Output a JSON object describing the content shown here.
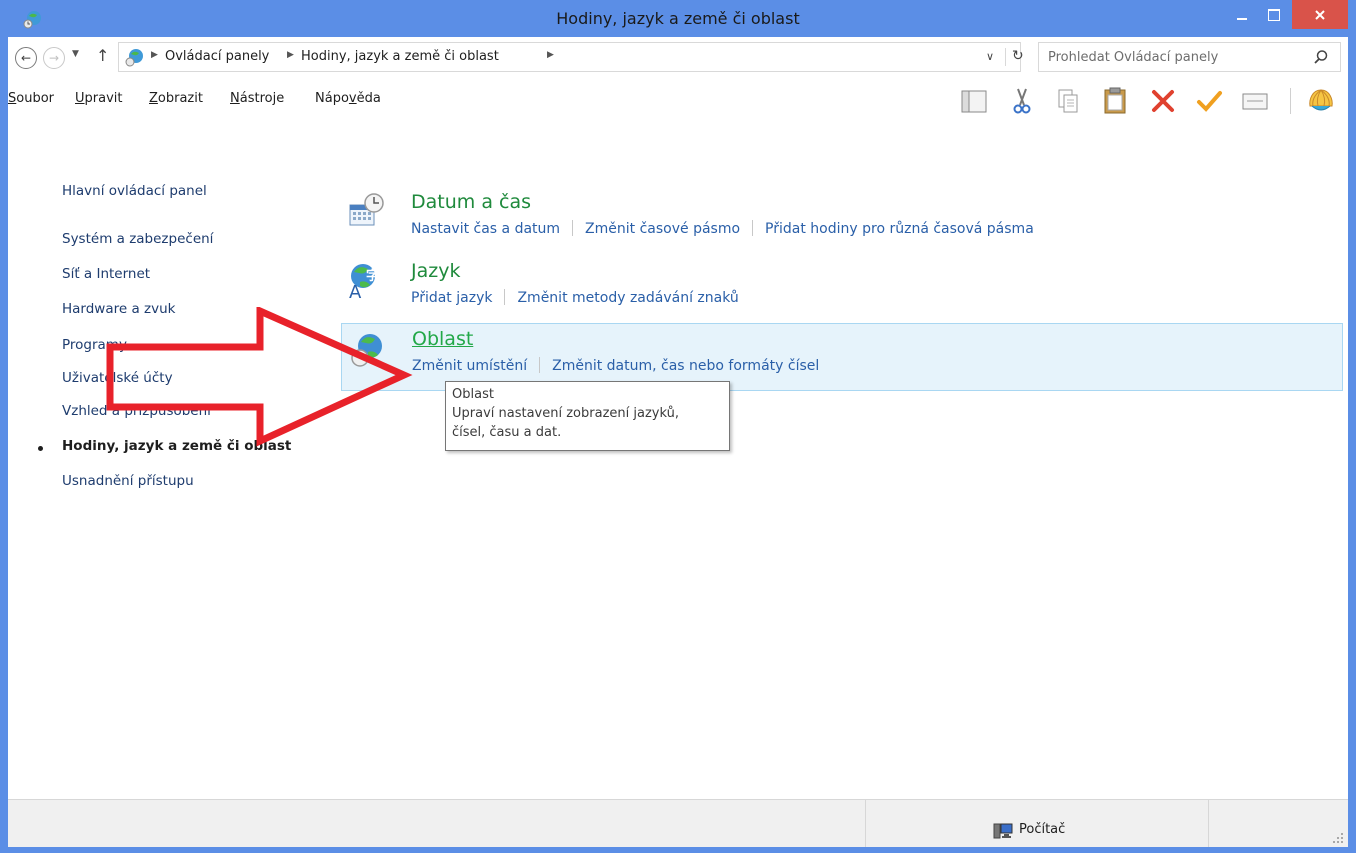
{
  "window": {
    "title": "Hodiny, jazyk a země či oblast",
    "accent": "#5b8ee6",
    "close_color": "#d9534a"
  },
  "address": {
    "crumbs": [
      "Ovládací panely",
      "Hodiny, jazyk a země či oblast"
    ],
    "search_placeholder": "Prohledat Ovládací panely"
  },
  "menu": {
    "items": [
      {
        "accel": "S",
        "rest": "oubor"
      },
      {
        "accel": "U",
        "rest": "pravit"
      },
      {
        "accel": "Z",
        "rest": "obrazit"
      },
      {
        "accel": "N",
        "rest": "ástroje"
      },
      {
        "pre": "Nápo",
        "accel": "v",
        "rest": "ěda"
      }
    ]
  },
  "sidebar": {
    "home": "Hlavní ovládací panel",
    "items": [
      "Systém a zabezpečení",
      "Síť a Internet",
      "Hardware a zvuk",
      "Programy",
      "Uživatelské účty",
      "Vzhled a přizpůsobení",
      "Hodiny, jazyk a země či oblast",
      "Usnadnění přístupu"
    ],
    "current_index": 6
  },
  "categories": [
    {
      "title": "Datum a čas",
      "icon": "calendar-clock-icon",
      "links": [
        "Nastavit čas a datum",
        "Změnit časové pásmo",
        "Přidat hodiny pro různá časová pásma"
      ]
    },
    {
      "title": "Jazyk",
      "icon": "language-globe-icon",
      "links": [
        "Přidat jazyk",
        "Změnit metody zadávání znaků"
      ]
    },
    {
      "title": "Oblast",
      "icon": "region-globe-clock-icon",
      "links": [
        "Změnit umístění",
        "Změnit datum, čas nebo formáty čísel"
      ],
      "highlighted": true
    }
  ],
  "tooltip": {
    "title": "Oblast",
    "line1": "Upraví nastavení zobrazení jazyků,",
    "line2": "čísel, času a dat."
  },
  "status": {
    "location": "Počítač"
  },
  "annotation": {
    "arrow_color": "#e8222a"
  }
}
